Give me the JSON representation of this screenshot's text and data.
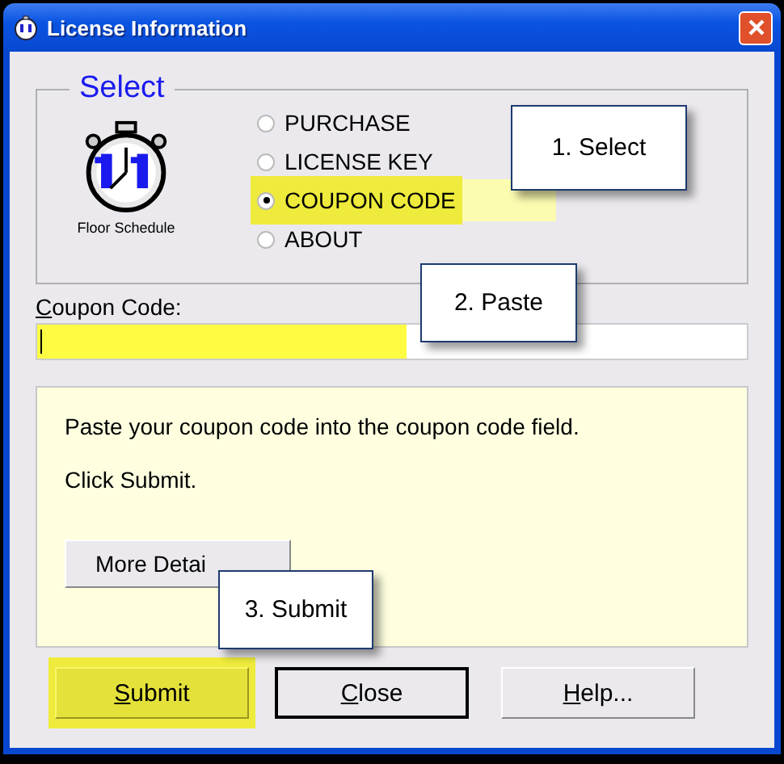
{
  "window": {
    "title": "License Information"
  },
  "group": {
    "title": "Select",
    "logo_caption": "Floor Schedule"
  },
  "options": [
    {
      "label": "PURCHASE",
      "selected": false,
      "highlighted": false
    },
    {
      "label": "LICENSE KEY",
      "selected": false,
      "highlighted": false
    },
    {
      "label": "COUPON CODE",
      "selected": true,
      "highlighted": true
    },
    {
      "label": "ABOUT",
      "selected": false,
      "highlighted": false
    }
  ],
  "field": {
    "label": "Coupon Code:",
    "highlighted": true
  },
  "info": {
    "lines": [
      "Paste your coupon code into the coupon code field.",
      "Click Submit."
    ],
    "button": "More Detai"
  },
  "buttons": [
    {
      "label": "Submit",
      "highlighted": true,
      "default": false
    },
    {
      "label": "Close",
      "highlighted": false,
      "default": true
    },
    {
      "label": "Help...",
      "highlighted": false,
      "default": false
    }
  ],
  "callouts": [
    {
      "text": "1. Select"
    },
    {
      "text": "2. Paste"
    },
    {
      "text": "3. Submit"
    }
  ]
}
